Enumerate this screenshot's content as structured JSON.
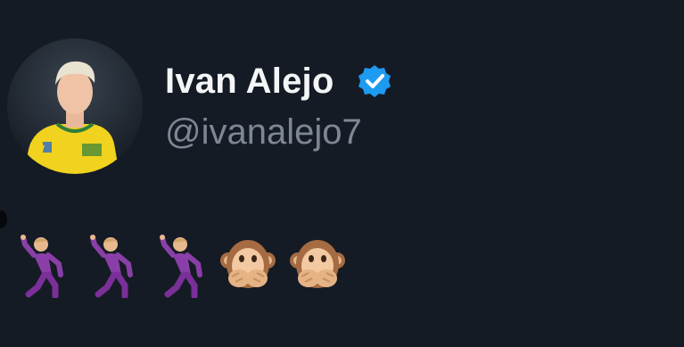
{
  "profile": {
    "display_name": "Ivan Alejo",
    "handle": "@ivanalejo7",
    "verified": true,
    "avatar_icon": "profile-photo-player-yellow-kit"
  },
  "tweet": {
    "emojis": [
      "dancing-man",
      "dancing-man",
      "dancing-man",
      "speak-no-evil-monkey",
      "speak-no-evil-monkey"
    ]
  },
  "colors": {
    "background": "#151b24",
    "name": "#f4f5f7",
    "handle": "#7d8893",
    "verified_badge": "#1d9bf0"
  }
}
